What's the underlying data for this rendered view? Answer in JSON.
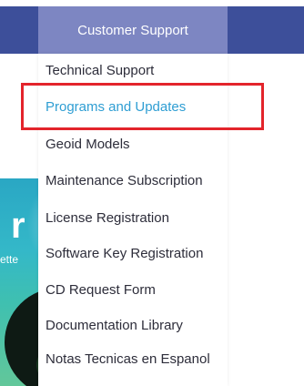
{
  "nav": {
    "active_tab_label": "Customer Support"
  },
  "hero": {
    "letter": "r",
    "subtitle": "ette"
  },
  "menu": {
    "items": [
      {
        "label": "Technical Support"
      },
      {
        "label": "Programs and Updates"
      },
      {
        "label": "Geoid Models"
      },
      {
        "label": "Maintenance Subscription"
      },
      {
        "label": "License Registration"
      },
      {
        "label": "Software Key Registration"
      },
      {
        "label": "CD Request Form"
      },
      {
        "label": "Documentation Library"
      },
      {
        "label": "Notas Tecnicas en Espanol"
      }
    ]
  },
  "colors": {
    "nav_bar": "#3d4f9a",
    "active_tab": "#7d86c2",
    "menu_text": "#2d2d3a",
    "highlighted_text": "#2f9ed3",
    "highlight_border": "#e3242b"
  }
}
